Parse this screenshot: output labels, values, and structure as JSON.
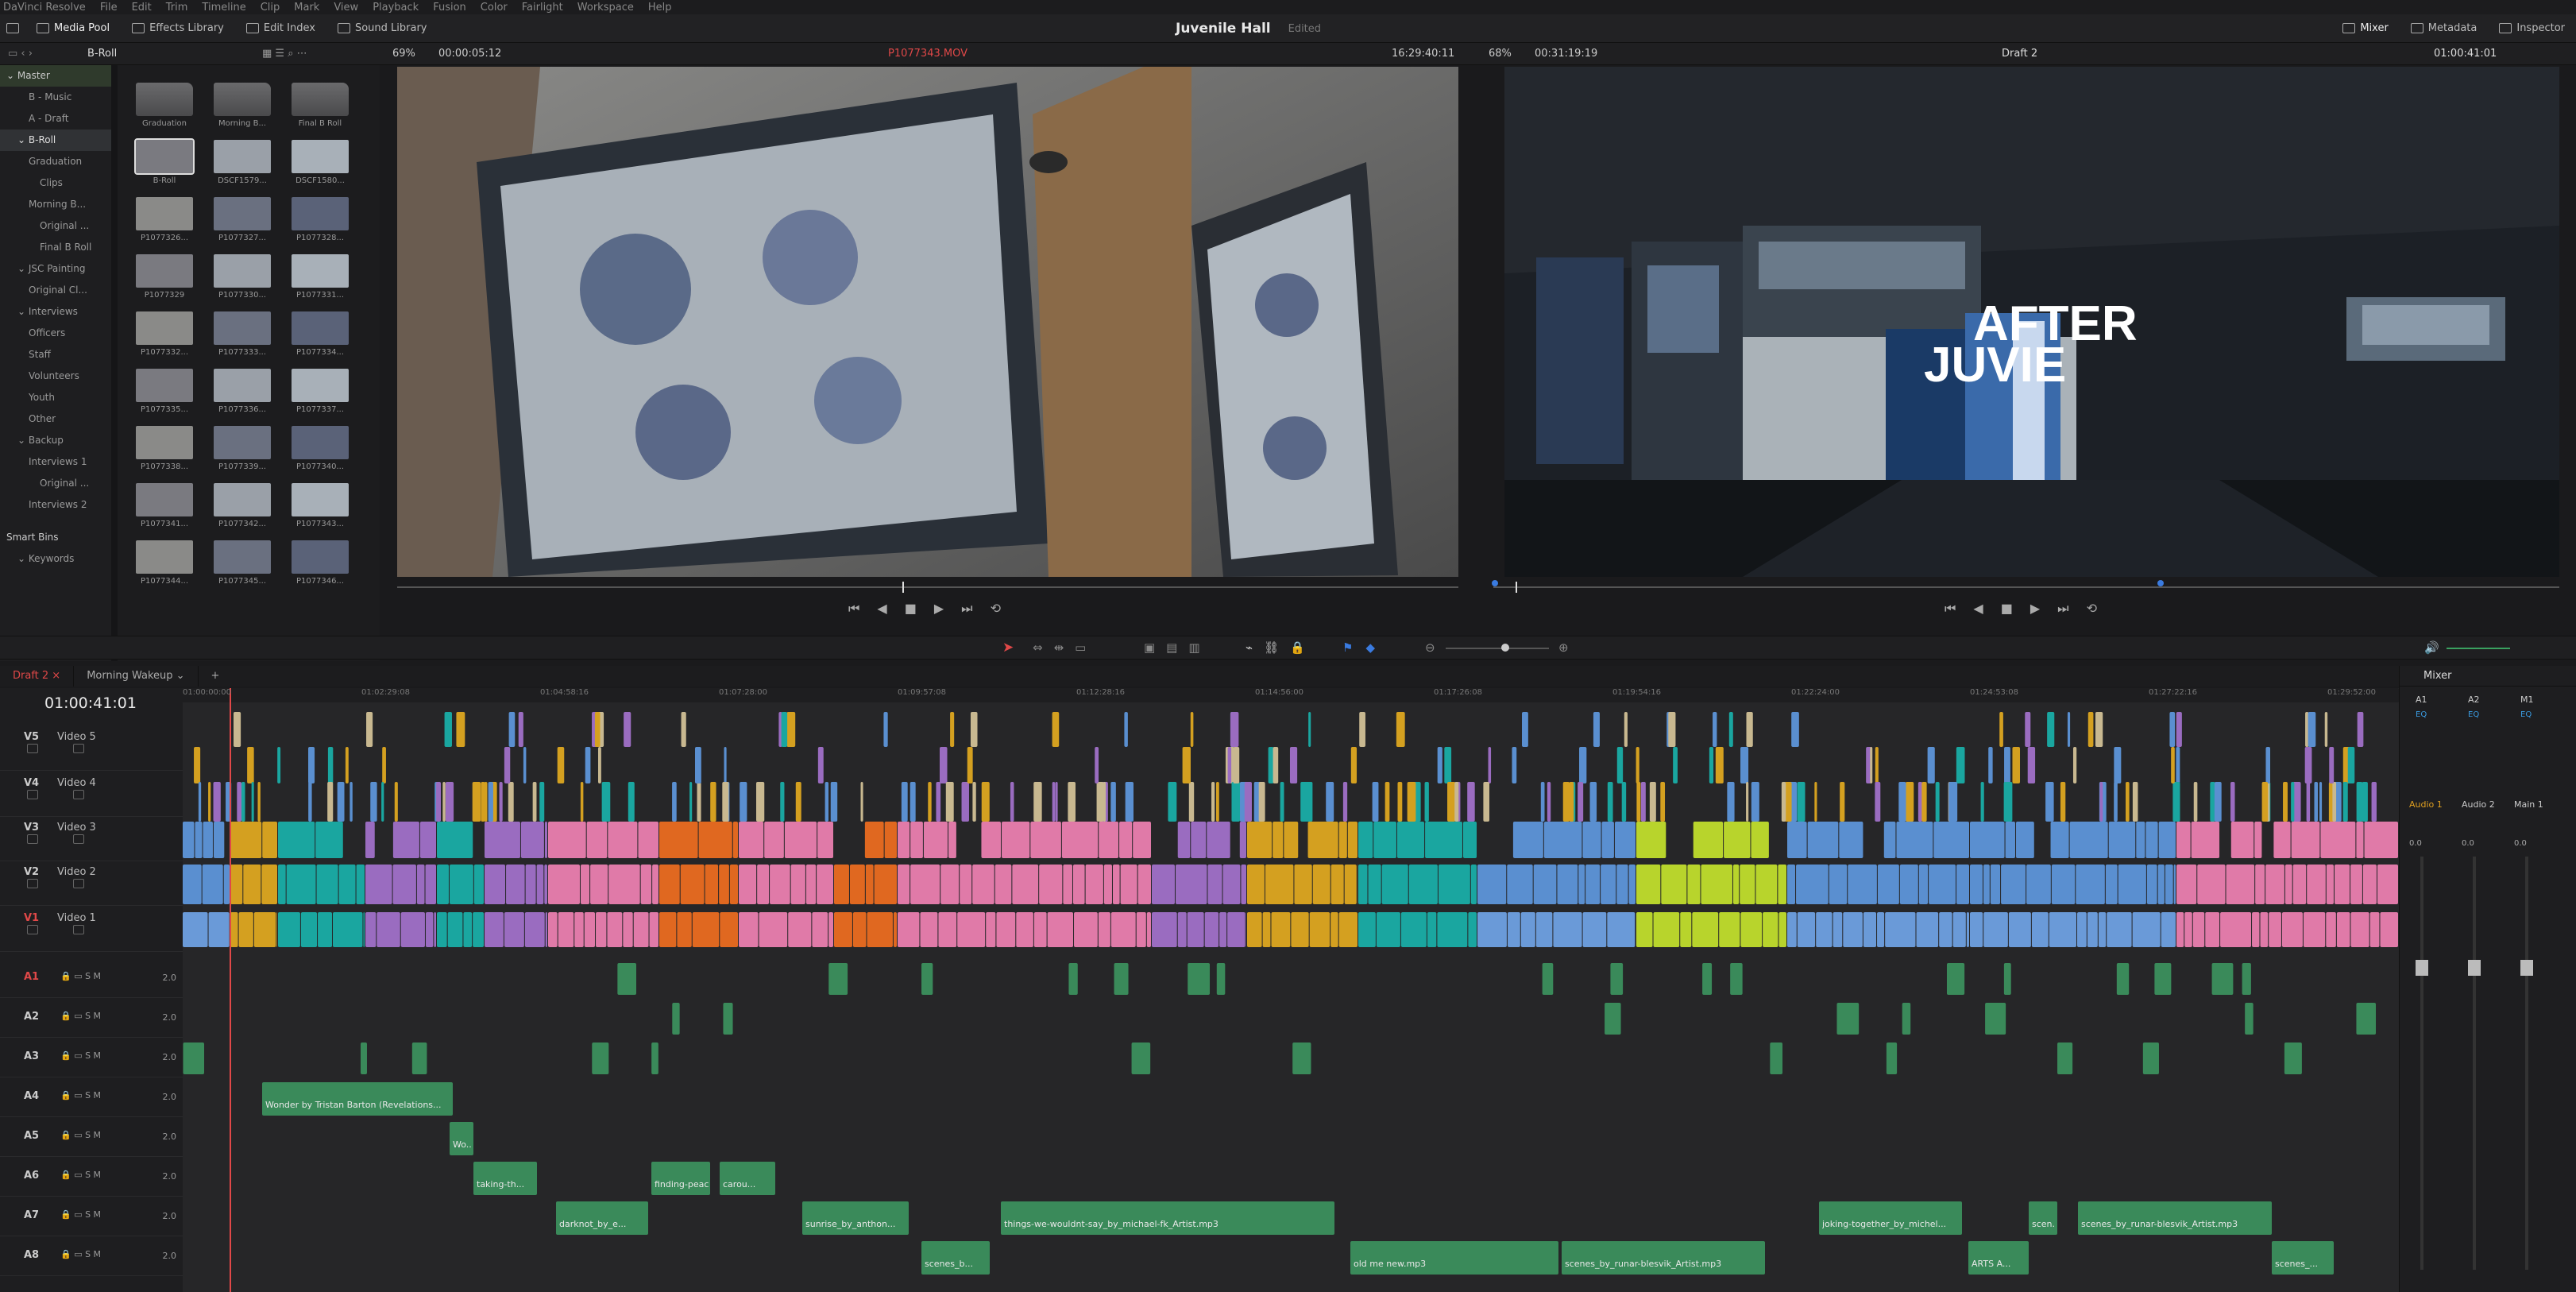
{
  "menu": [
    "DaVinci Resolve",
    "File",
    "Edit",
    "Trim",
    "Timeline",
    "Clip",
    "Mark",
    "View",
    "Playback",
    "Fusion",
    "Color",
    "Fairlight",
    "Workspace",
    "Help"
  ],
  "toolbar": {
    "media_pool": "Media Pool",
    "effects_library": "Effects Library",
    "edit_index": "Edit Index",
    "sound_library": "Sound Library",
    "mixer": "Mixer",
    "metadata": "Metadata",
    "inspector": "Inspector"
  },
  "project": {
    "title": "Juvenile Hall",
    "status": "Edited"
  },
  "source_viewer": {
    "bin": "B-Roll",
    "zoom": "69%",
    "timecode": "00:00:05:12",
    "clip": "P1077343.MOV",
    "position": "16:29:40:11"
  },
  "timeline_viewer": {
    "zoom": "68%",
    "duration": "00:31:19:19",
    "timeline": "Draft 2",
    "timecode": "01:00:41:01"
  },
  "bins": [
    {
      "label": "Master",
      "depth": 0,
      "style": "master"
    },
    {
      "label": "B - Music",
      "depth": 2
    },
    {
      "label": "A - Draft",
      "depth": 2
    },
    {
      "label": "B-Roll",
      "depth": 1,
      "style": "sel"
    },
    {
      "label": "Graduation",
      "depth": 2
    },
    {
      "label": "Clips",
      "depth": 3
    },
    {
      "label": "Morning B...",
      "depth": 2
    },
    {
      "label": "Original ...",
      "depth": 3
    },
    {
      "label": "Final B Roll",
      "depth": 3
    },
    {
      "label": "JSC Painting",
      "depth": 1
    },
    {
      "label": "Original Cl...",
      "depth": 2
    },
    {
      "label": "Interviews",
      "depth": 1
    },
    {
      "label": "Officers",
      "depth": 2
    },
    {
      "label": "Staff",
      "depth": 2
    },
    {
      "label": "Volunteers",
      "depth": 2
    },
    {
      "label": "Youth",
      "depth": 2
    },
    {
      "label": "Other",
      "depth": 2
    },
    {
      "label": "Backup",
      "depth": 1
    },
    {
      "label": "Interviews 1",
      "depth": 2
    },
    {
      "label": "Original ...",
      "depth": 3
    },
    {
      "label": "Interviews 2",
      "depth": 2
    },
    {
      "label": "Smart Bins",
      "depth": 0,
      "style": "head"
    },
    {
      "label": "Keywords",
      "depth": 1
    }
  ],
  "clips": [
    "Graduation",
    "Morning B...",
    "Final B Roll",
    "B-Roll",
    "DSCF1579...",
    "DSCF1580...",
    "P1077326...",
    "P1077327...",
    "P1077328...",
    "P1077329",
    "P1077330...",
    "P1077331...",
    "P1077332...",
    "P1077333...",
    "P1077334...",
    "P1077335...",
    "P1077336...",
    "P1077337...",
    "P1077338...",
    "P1077339...",
    "P1077340...",
    "P1077341...",
    "P1077342...",
    "P1077343...",
    "P1077344...",
    "P1077345...",
    "P1077346..."
  ],
  "overlay_title": [
    "AFTER",
    "JUVIE"
  ],
  "timeline": {
    "tabs": [
      "Draft 2",
      "Morning Wakeup"
    ],
    "timecode": "01:00:41:01",
    "ruler": [
      "01:00:00:00",
      "01:02:29:08",
      "01:04:58:16",
      "01:07:28:00",
      "01:09:57:08",
      "01:12:28:16",
      "01:14:56:00",
      "01:17:26:08",
      "01:19:54:16",
      "01:22:24:00",
      "01:24:53:08",
      "01:27:22:16",
      "01:29:52:00"
    ],
    "video_tracks": [
      {
        "id": "V5",
        "name": "Video 5"
      },
      {
        "id": "V4",
        "name": "Video 4"
      },
      {
        "id": "V3",
        "name": "Video 3"
      },
      {
        "id": "V2",
        "name": "Video 2"
      },
      {
        "id": "V1",
        "name": "Video 1"
      }
    ],
    "audio_tracks": [
      {
        "id": "A1",
        "vol": "2.0"
      },
      {
        "id": "A2",
        "vol": "2.0"
      },
      {
        "id": "A3",
        "vol": "2.0"
      },
      {
        "id": "A4",
        "vol": "2.0"
      },
      {
        "id": "A5",
        "vol": "2.0"
      },
      {
        "id": "A6",
        "vol": "2.0"
      },
      {
        "id": "A7",
        "vol": "2.0"
      },
      {
        "id": "A8",
        "vol": "2.0"
      }
    ],
    "audio_clip_labels": [
      "Wonder by Tristan Barton (Revelations...",
      "Wo...",
      "taking-th...",
      "darknot_by_e...",
      "finding-peac...",
      "carou...",
      "sunrise_by_anthon...",
      "scenes_b...",
      "things-we-wouldnt-say_by_michael-fk_Artist.mp3",
      "old me new.mp3",
      "scenes_by_runar-blesvik_Artist.mp3",
      "joking-together_by_michel...",
      "ARTS A...",
      "scen...",
      "scenes_by_runar-blesvik_Artist.mp3",
      "scenes_..."
    ]
  },
  "mixer": {
    "title": "Mixer",
    "channels": [
      "A1",
      "A2",
      "M1"
    ],
    "names": [
      "Audio 1",
      "Audio 2",
      "Main 1"
    ],
    "eq": "EQ",
    "value": "0.0"
  },
  "colors": {
    "accent_red": "#e04848",
    "pink": "#e07aa8",
    "orange": "#e06820",
    "lime": "#b8d42c",
    "teal": "#1aa6a0",
    "purple": "#9a6cc0",
    "blue": "#5a8fd0",
    "audio_green": "#3a8a5a",
    "tan": "#c8b890",
    "gold": "#d4a020"
  }
}
